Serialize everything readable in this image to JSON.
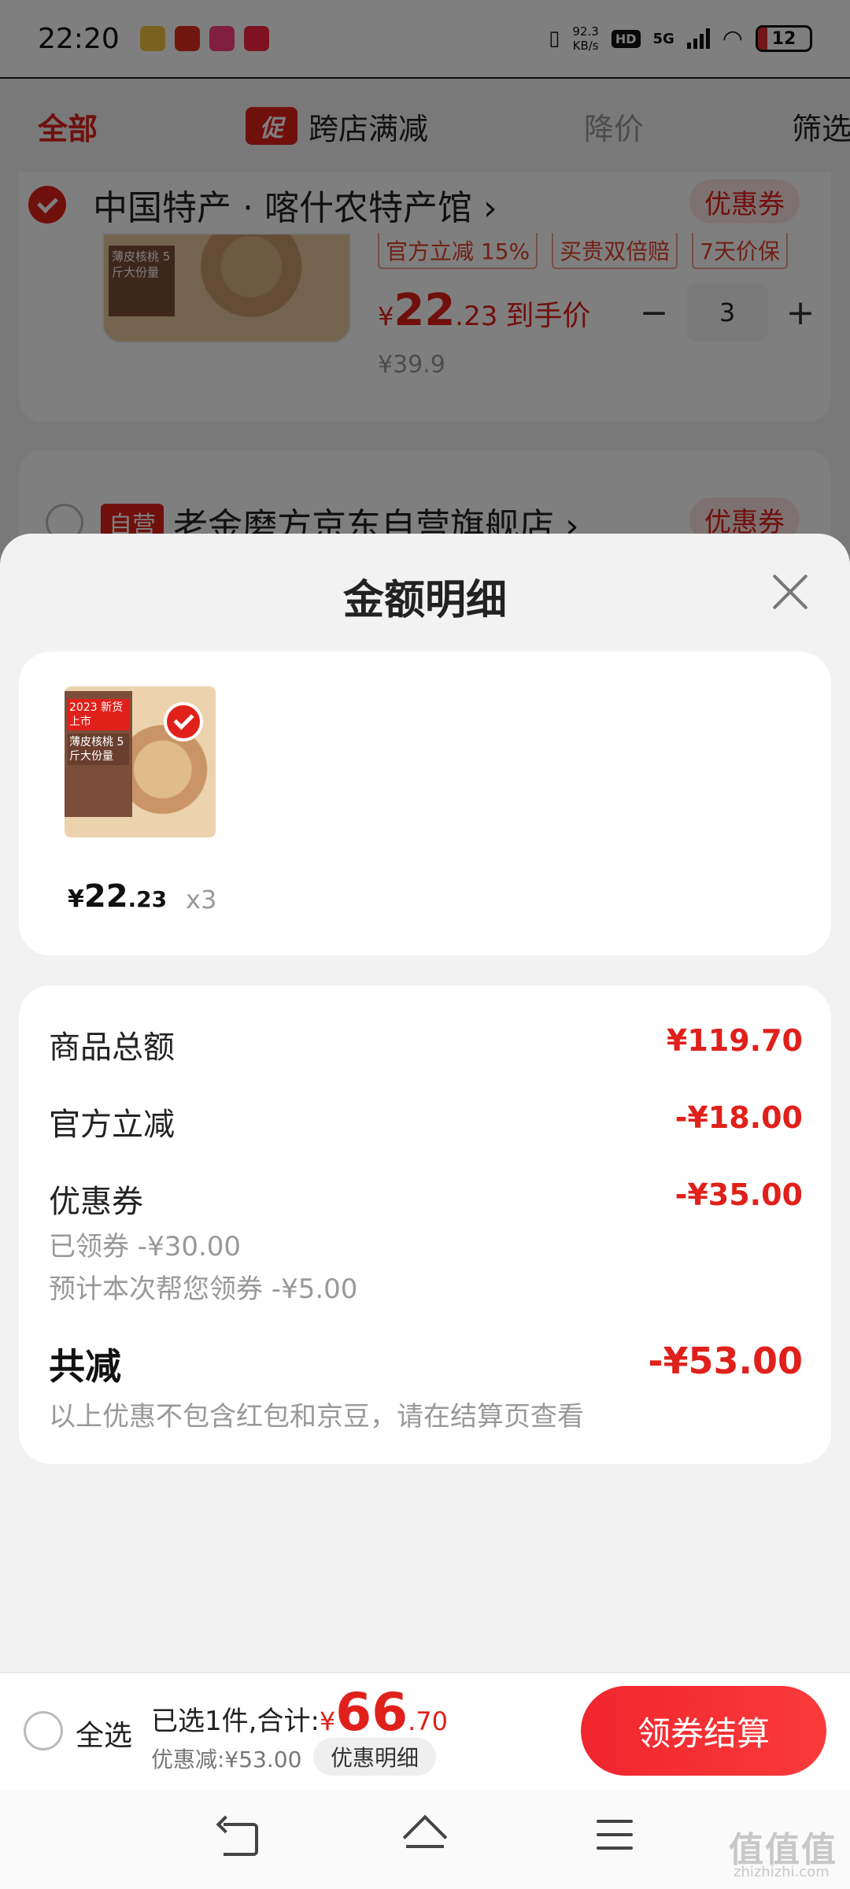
{
  "status_bar": {
    "time": "22:20",
    "net_speed_value": "92.3",
    "net_speed_unit": "KB/s",
    "hd": "HD",
    "network": "5G",
    "battery": "12"
  },
  "filter_bar": {
    "tab_all": "全部",
    "promo_badge": "促",
    "tab_cross_store": "跨店满减",
    "tab_price_drop": "降价",
    "tab_filter": "筛选"
  },
  "cart": {
    "shop1": {
      "name": "中国特产 · 喀什农特产馆 ›",
      "coupon": "优惠券",
      "thumb_text": "薄皮核桃 5斤大份量",
      "tags": [
        "官方立减 15%",
        "买贵双倍赔",
        "7天价保"
      ],
      "price_currency": "¥",
      "price_int": "22",
      "price_dec": ".23",
      "price_suffix": "到手价",
      "original_price": "¥39.9",
      "qty": "3",
      "minus": "−",
      "plus": "+"
    },
    "shop2": {
      "badge": "自营",
      "name": "老金磨方京东自营旗舰店 ›",
      "coupon": "优惠券"
    }
  },
  "modal": {
    "title": "金额明细",
    "item": {
      "box_line1": "2023 新货上市",
      "box_line2": "薄皮核桃 5斤大份量",
      "price_currency": "¥",
      "price_int": "22",
      "price_dec": ".23",
      "qty": "x3"
    },
    "rows": {
      "goods_total_label": "商品总额",
      "goods_total_amount": "¥119.70",
      "official_cut_label": "官方立减",
      "official_cut_amount": "-¥18.00",
      "coupon_label": "优惠券",
      "coupon_amount": "-¥35.00",
      "coupon_claimed": "已领券 -¥30.00",
      "coupon_estimated": "预计本次帮您领券 -¥5.00",
      "total_cut_label": "共减",
      "total_cut_amount": "-¥53.00",
      "note": "以上优惠不包含红包和京豆，请在结算页查看"
    }
  },
  "bottom_bar": {
    "select_all": "全选",
    "sum_label": "已选1件,合计:",
    "sum_currency": "¥",
    "sum_int": "66",
    "sum_dec": ".70",
    "discount_text": "优惠减:¥53.00",
    "detail_button": "优惠明细",
    "checkout_button": "领券结算"
  },
  "watermark": {
    "text": "值值值",
    "url": "zhizhizhi.com"
  },
  "colors": {
    "accent": "#e0201a",
    "checkout_gradient_start": "#f0262e",
    "checkout_gradient_end": "#fa3a3a"
  }
}
